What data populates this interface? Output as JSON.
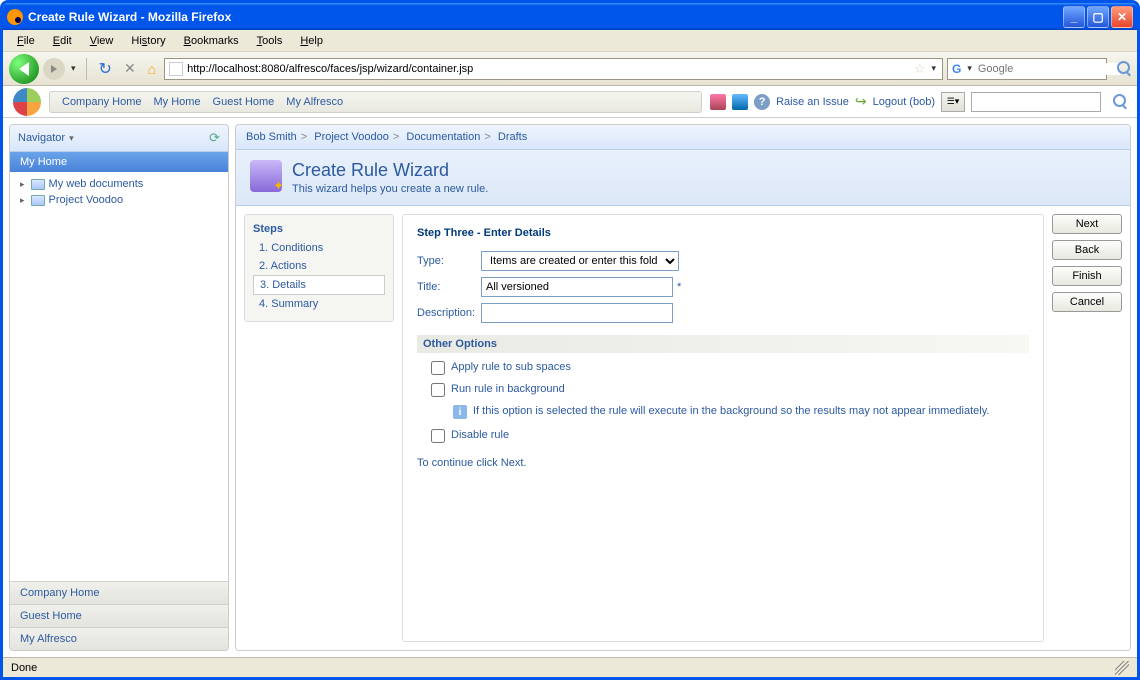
{
  "window": {
    "title": "Create Rule Wizard - Mozilla Firefox"
  },
  "menubar": {
    "file": "File",
    "edit": "Edit",
    "view": "View",
    "history": "History",
    "bookmarks": "Bookmarks",
    "tools": "Tools",
    "help": "Help"
  },
  "navbar": {
    "url": "http://localhost:8080/alfresco/faces/jsp/wizard/container.jsp",
    "search_placeholder": "Google"
  },
  "alf_top": {
    "links": [
      "Company Home",
      "My Home",
      "Guest Home",
      "My Alfresco"
    ],
    "raise_issue": "Raise an Issue",
    "logout": "Logout (bob)"
  },
  "sidebar": {
    "navigator": "Navigator",
    "active": "My Home",
    "tree": [
      "My web documents",
      "Project Voodoo"
    ],
    "quick": [
      "Company Home",
      "Guest Home",
      "My Alfresco"
    ]
  },
  "breadcrumb": [
    "Bob Smith",
    "Project Voodoo",
    "Documentation",
    "Drafts"
  ],
  "wizard": {
    "title": "Create Rule Wizard",
    "desc": "This wizard helps you create a new rule.",
    "steps_label": "Steps",
    "steps": [
      "1. Conditions",
      "2. Actions",
      "3. Details",
      "4. Summary"
    ],
    "current_step_index": 2,
    "step_heading": "Step Three - Enter Details",
    "form": {
      "type_label": "Type:",
      "type_value": "Items are created or enter this folder",
      "title_label": "Title:",
      "title_value": "All versioned",
      "desc_label": "Description:",
      "desc_value": ""
    },
    "other_options": "Other Options",
    "checks": {
      "apply_sub": "Apply rule to sub spaces",
      "background": "Run rule in background",
      "background_info": "If this option is selected the rule will execute in the background so the results may not appear immediately.",
      "disable": "Disable rule"
    },
    "continue": "To continue click Next.",
    "buttons": {
      "next": "Next",
      "back": "Back",
      "finish": "Finish",
      "cancel": "Cancel"
    }
  },
  "statusbar": {
    "text": "Done"
  }
}
